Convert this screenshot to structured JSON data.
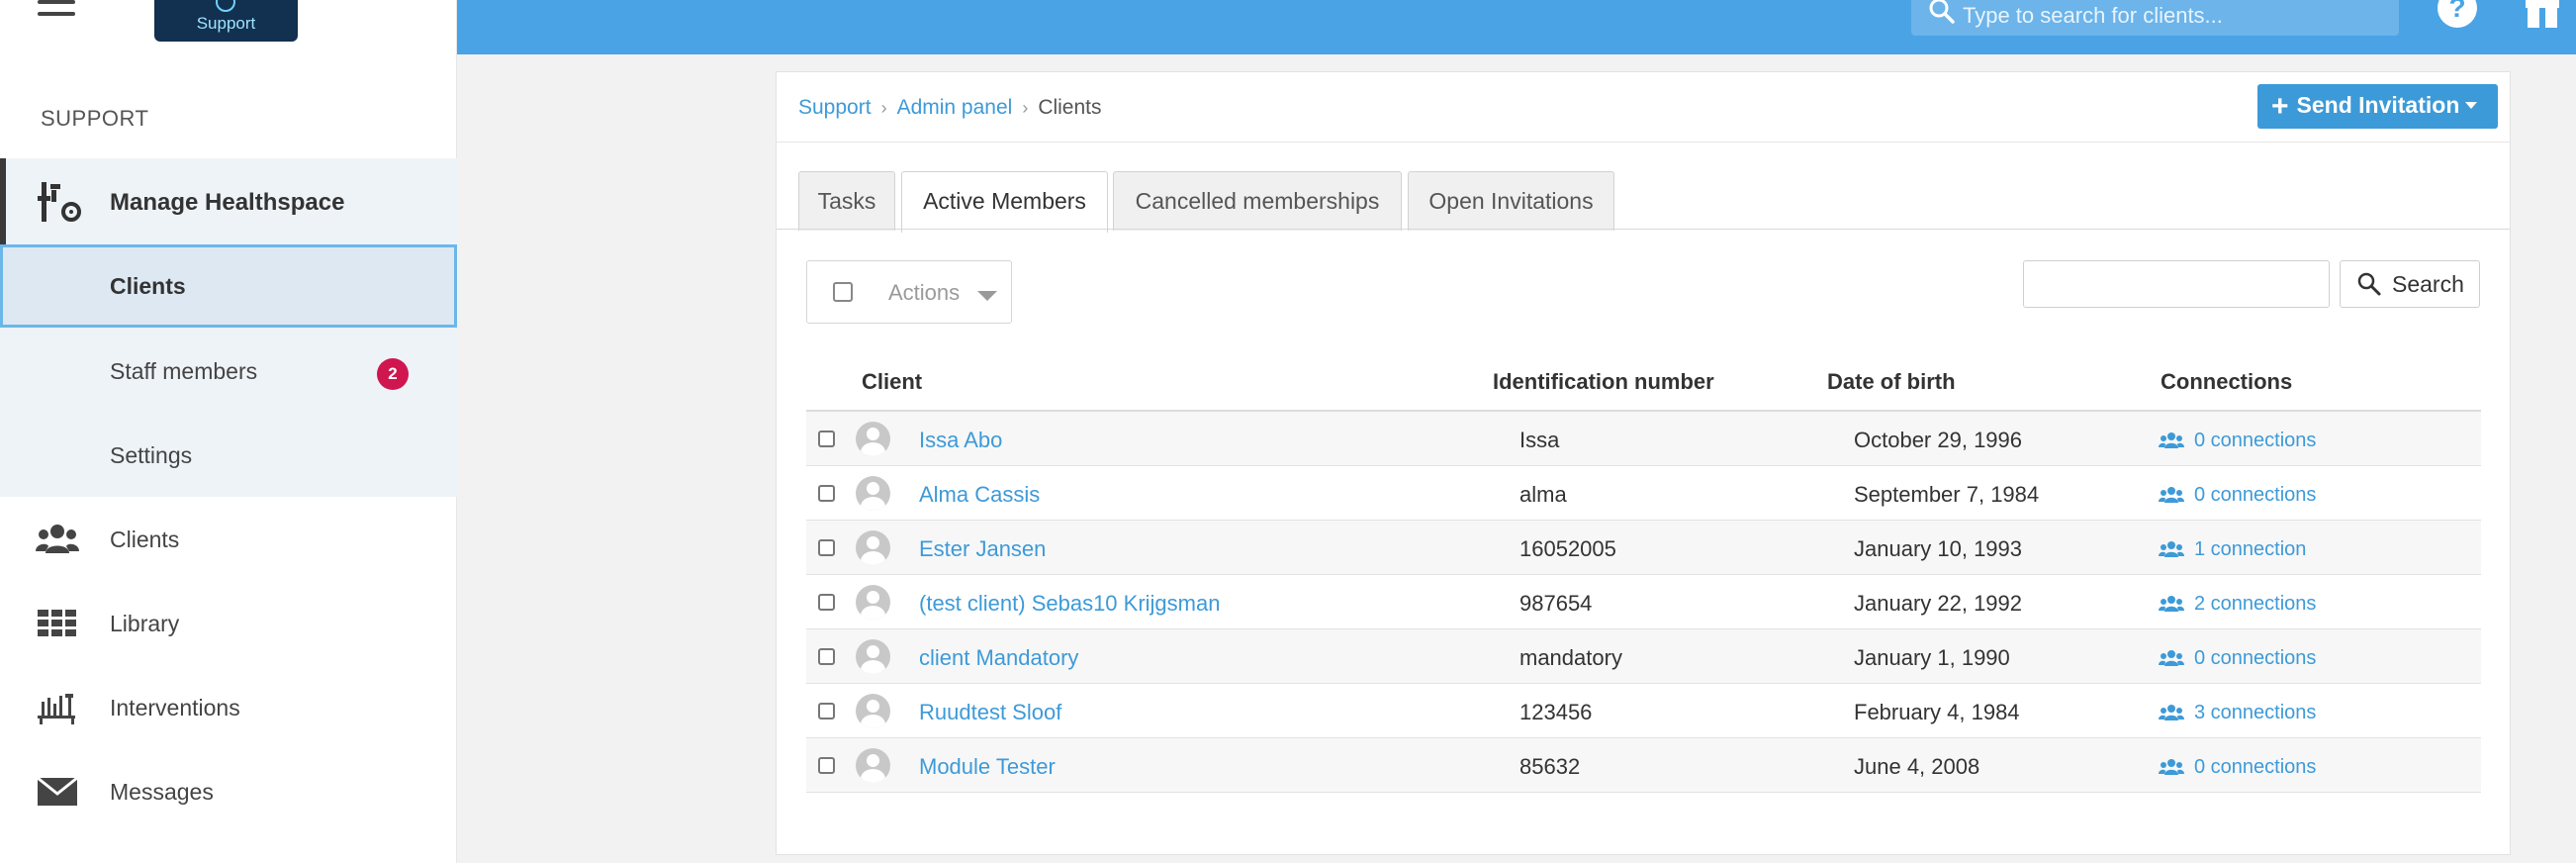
{
  "sidebar": {
    "section_label": "SUPPORT",
    "logo_text": "Support",
    "manage": {
      "label": "Manage Healthspace"
    },
    "subitems": [
      {
        "label": "Clients",
        "active": true
      },
      {
        "label": "Staff members",
        "badge": "2"
      },
      {
        "label": "Settings"
      }
    ],
    "nav": [
      {
        "label": "Clients",
        "icon": "users-icon"
      },
      {
        "label": "Library",
        "icon": "grid-icon"
      },
      {
        "label": "Interventions",
        "icon": "interventions-icon"
      },
      {
        "label": "Messages",
        "icon": "envelope-icon"
      }
    ]
  },
  "topbar": {
    "search_placeholder": "Type to search for clients...",
    "help_label": "?"
  },
  "breadcrumb": {
    "items": [
      "Support",
      "Admin panel"
    ],
    "current": "Clients"
  },
  "send_invitation_label": "Send Invitation",
  "tabs": [
    {
      "label": "Tasks"
    },
    {
      "label": "Active Members",
      "active": true
    },
    {
      "label": "Cancelled memberships"
    },
    {
      "label": "Open Invitations"
    }
  ],
  "toolbar": {
    "actions_label": "Actions",
    "search_label": "Search"
  },
  "table": {
    "headers": [
      "Client",
      "Identification number",
      "Date of birth",
      "Connections"
    ],
    "rows": [
      {
        "name": "Issa Abo",
        "ident": "Issa",
        "dob": "October 29, 1996",
        "connections": "0 connections"
      },
      {
        "name": "Alma Cassis",
        "ident": "alma",
        "dob": "September 7, 1984",
        "connections": "0 connections"
      },
      {
        "name": "Ester Jansen",
        "ident": "16052005",
        "dob": "January 10, 1993",
        "connections": "1 connection"
      },
      {
        "name": "(test client) Sebas10 Krijgsman",
        "ident": "987654",
        "dob": "January 22, 1992",
        "connections": "2 connections"
      },
      {
        "name": "client Mandatory",
        "ident": "mandatory",
        "dob": "January 1, 1990",
        "connections": "0 connections"
      },
      {
        "name": "Ruudtest Sloof",
        "ident": "123456",
        "dob": "February 4, 1984",
        "connections": "3 connections"
      },
      {
        "name": "Module Tester",
        "ident": "85632",
        "dob": "June 4, 2008",
        "connections": "0 connections"
      }
    ]
  },
  "colors": {
    "accent": "#4aa3e4",
    "link": "#3d9ad8",
    "badge": "#d0164f"
  }
}
